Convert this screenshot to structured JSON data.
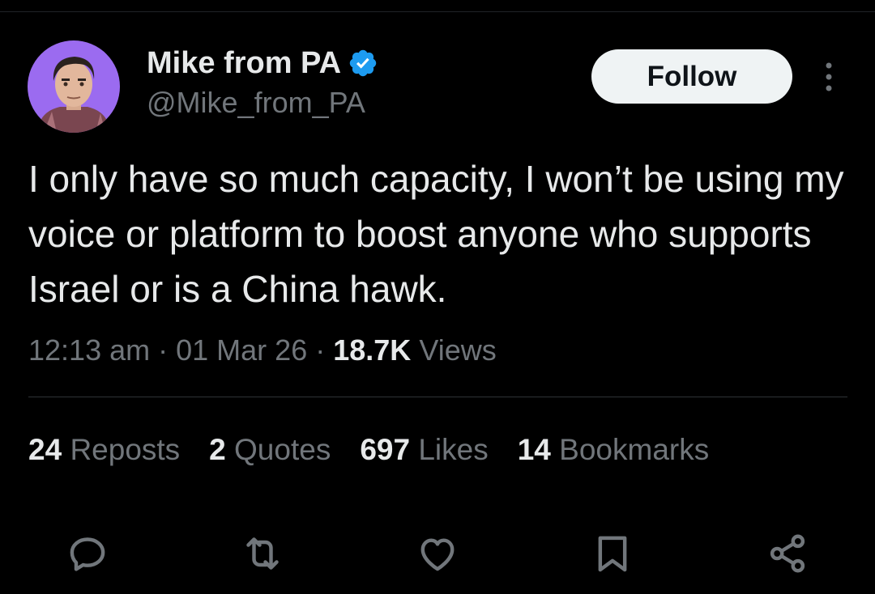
{
  "author": {
    "display_name": "Mike from PA",
    "handle": "@Mike_from_PA",
    "verified_icon": "verified-badge-icon",
    "avatar_bg": "#9b6bf0"
  },
  "follow_label": "Follow",
  "more_icon": "more-vertical-icon",
  "tweet": {
    "text": "I only have so much capacity, I won’t be using my voice or platform to boost anyone who supports Israel or is a China hawk.",
    "time": "12:13 am",
    "date": "01 Mar 26",
    "views_count": "18.7K",
    "views_label": "Views"
  },
  "stats": [
    {
      "count": "24",
      "label": "Reposts"
    },
    {
      "count": "2",
      "label": "Quotes"
    },
    {
      "count": "697",
      "label": "Likes"
    },
    {
      "count": "14",
      "label": "Bookmarks"
    }
  ],
  "actions": [
    "reply-icon",
    "repost-icon",
    "like-icon",
    "bookmark-icon",
    "share-icon"
  ],
  "colors": {
    "background": "#000000",
    "primary_text": "#e7e9ea",
    "secondary_text": "#71767b",
    "verified": "#1d9bf0",
    "follow_bg": "#eff3f4"
  }
}
